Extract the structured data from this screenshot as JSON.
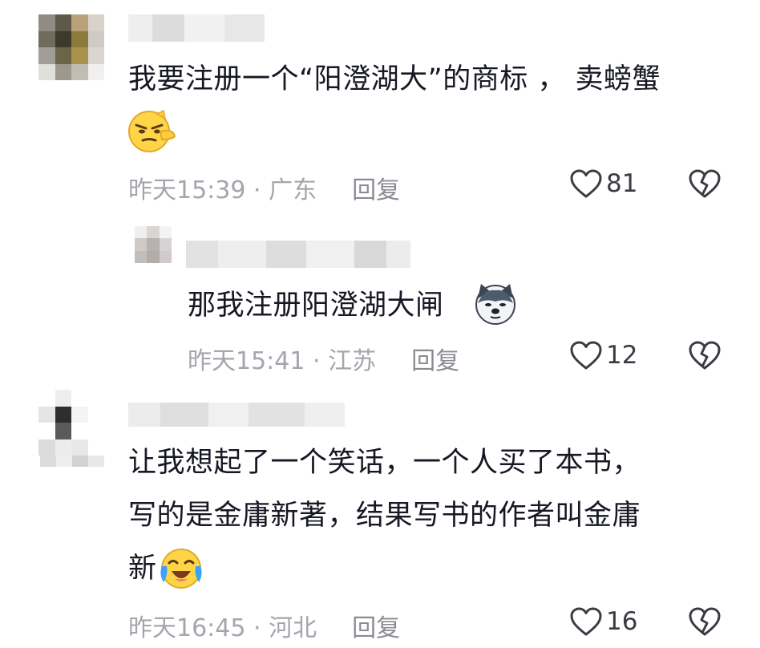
{
  "comments": [
    {
      "text_lines": [
        "我要注册一个“阳澄湖大”的商标 ， 卖螃蟹"
      ],
      "emoji": "smirk-pointing-emoji",
      "meta_time_location": "昨天15:39 · 广东",
      "reply_label": "回复",
      "likes": "81"
    },
    {
      "text_lines": [
        "那我注册阳澄湖大闸"
      ],
      "emoji": "husky-dog-emoji",
      "meta_time_location": "昨天15:41 · 江苏",
      "reply_label": "回复",
      "likes": "12"
    },
    {
      "text_lines": [
        "让我想起了一个笑话，一个人买了本书，",
        "写的是金庸新著，结果写书的作者叫金庸",
        "新"
      ],
      "emoji": "laughing-crying-emoji",
      "meta_time_location": "昨天16:45 · 河北",
      "reply_label": "回复",
      "likes": "16"
    }
  ],
  "colors": {
    "text": "#161823",
    "meta": "#a4a6ad",
    "icon": "#3a3c44"
  }
}
